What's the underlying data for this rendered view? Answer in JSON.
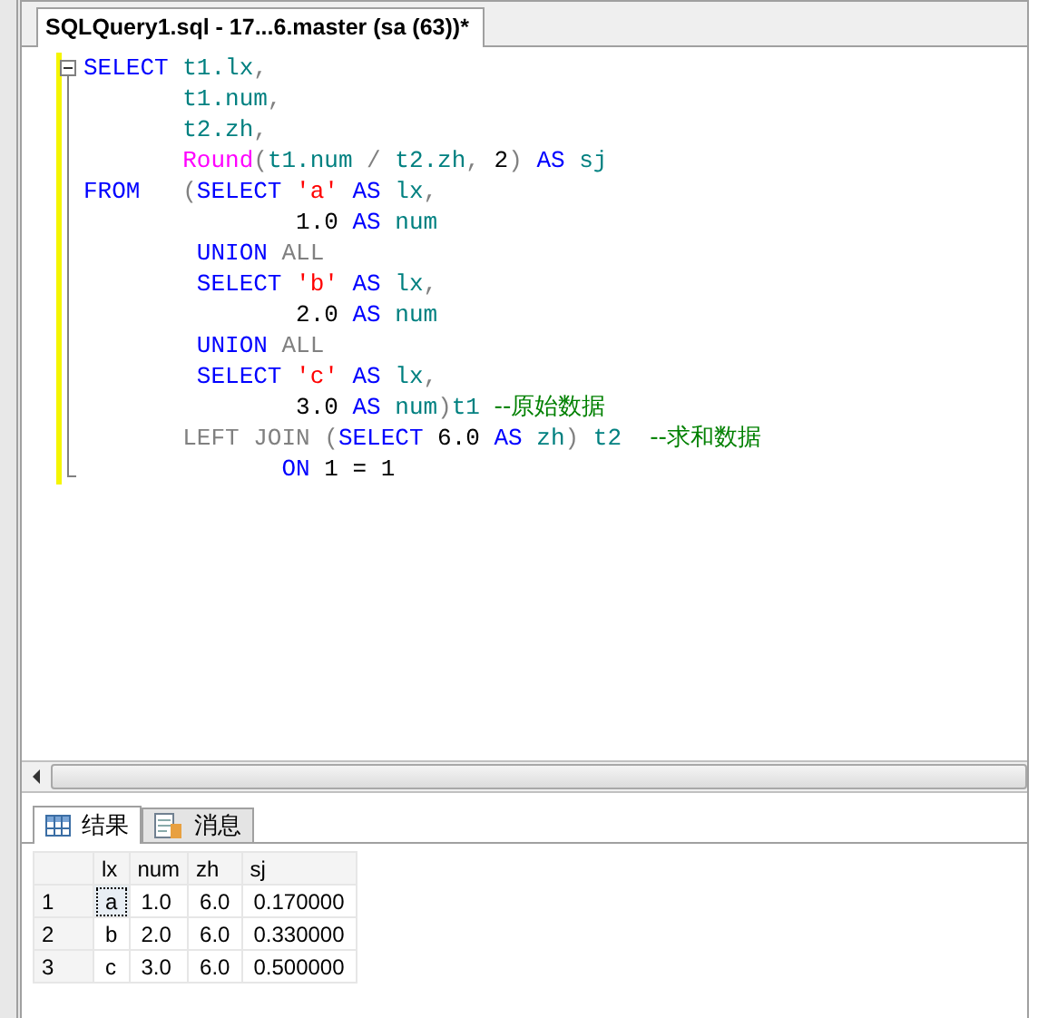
{
  "document_tab": {
    "title": "SQLQuery1.sql - 17...6.master (sa (63))*",
    "selected": true
  },
  "editor": {
    "lines": [
      {
        "changed": true,
        "tokens": [
          {
            "kind": "keyword",
            "text": "SELECT "
          },
          {
            "kind": "identifier",
            "text": "t1.lx"
          },
          {
            "kind": "operator",
            "text": ","
          }
        ]
      },
      {
        "changed": true,
        "tokens": [
          {
            "kind": "identifier",
            "text": "       t1.num"
          },
          {
            "kind": "operator",
            "text": ","
          }
        ]
      },
      {
        "changed": true,
        "tokens": [
          {
            "kind": "identifier",
            "text": "       t2.zh"
          },
          {
            "kind": "operator",
            "text": ","
          }
        ]
      },
      {
        "changed": true,
        "tokens": [
          {
            "kind": "function",
            "text": "       Round"
          },
          {
            "kind": "operator",
            "text": "("
          },
          {
            "kind": "identifier",
            "text": "t1.num"
          },
          {
            "kind": "operator",
            "text": " / "
          },
          {
            "kind": "identifier",
            "text": "t2.zh"
          },
          {
            "kind": "operator",
            "text": ", "
          },
          {
            "kind": "number",
            "text": "2"
          },
          {
            "kind": "operator",
            "text": ")"
          },
          {
            "kind": "keyword",
            "text": " AS "
          },
          {
            "kind": "identifier",
            "text": "sj"
          }
        ]
      },
      {
        "changed": true,
        "tokens": [
          {
            "kind": "keyword",
            "text": "FROM   "
          },
          {
            "kind": "operator",
            "text": "("
          },
          {
            "kind": "keyword",
            "text": "SELECT "
          },
          {
            "kind": "string",
            "text": "'a'"
          },
          {
            "kind": "keyword",
            "text": " AS "
          },
          {
            "kind": "identifier",
            "text": "lx"
          },
          {
            "kind": "operator",
            "text": ","
          }
        ]
      },
      {
        "changed": true,
        "tokens": [
          {
            "kind": "number",
            "text": "               1.0"
          },
          {
            "kind": "keyword",
            "text": " AS "
          },
          {
            "kind": "identifier",
            "text": "num"
          }
        ]
      },
      {
        "changed": true,
        "tokens": [
          {
            "kind": "keyword",
            "text": "        UNION "
          },
          {
            "kind": "operator",
            "text": "ALL"
          }
        ]
      },
      {
        "changed": true,
        "tokens": [
          {
            "kind": "keyword",
            "text": "        SELECT "
          },
          {
            "kind": "string",
            "text": "'b'"
          },
          {
            "kind": "keyword",
            "text": " AS "
          },
          {
            "kind": "identifier",
            "text": "lx"
          },
          {
            "kind": "operator",
            "text": ","
          }
        ]
      },
      {
        "changed": true,
        "tokens": [
          {
            "kind": "number",
            "text": "               2.0"
          },
          {
            "kind": "keyword",
            "text": " AS "
          },
          {
            "kind": "identifier",
            "text": "num"
          }
        ]
      },
      {
        "changed": true,
        "tokens": [
          {
            "kind": "keyword",
            "text": "        UNION "
          },
          {
            "kind": "operator",
            "text": "ALL"
          }
        ]
      },
      {
        "changed": true,
        "tokens": [
          {
            "kind": "keyword",
            "text": "        SELECT "
          },
          {
            "kind": "string",
            "text": "'c'"
          },
          {
            "kind": "keyword",
            "text": " AS "
          },
          {
            "kind": "identifier",
            "text": "lx"
          },
          {
            "kind": "operator",
            "text": ","
          }
        ]
      },
      {
        "changed": true,
        "tokens": [
          {
            "kind": "number",
            "text": "               3.0"
          },
          {
            "kind": "keyword",
            "text": " AS "
          },
          {
            "kind": "identifier",
            "text": "num"
          },
          {
            "kind": "operator",
            "text": ")"
          },
          {
            "kind": "identifier",
            "text": "t1 "
          },
          {
            "kind": "comment",
            "text": "--原始数据"
          }
        ]
      },
      {
        "changed": true,
        "tokens": [
          {
            "kind": "operator",
            "text": "       LEFT JOIN "
          },
          {
            "kind": "operator",
            "text": "("
          },
          {
            "kind": "keyword",
            "text": "SELECT "
          },
          {
            "kind": "number",
            "text": "6.0"
          },
          {
            "kind": "keyword",
            "text": " AS "
          },
          {
            "kind": "identifier",
            "text": "zh"
          },
          {
            "kind": "operator",
            "text": ") "
          },
          {
            "kind": "identifier",
            "text": "t2  "
          },
          {
            "kind": "comment",
            "text": "--求和数据"
          }
        ]
      },
      {
        "changed": true,
        "tokens": [
          {
            "kind": "keyword",
            "text": "              ON "
          },
          {
            "kind": "number",
            "text": "1 = 1"
          }
        ]
      }
    ]
  },
  "result_tabs": [
    {
      "label": "结果",
      "kind": "grid",
      "selected": true
    },
    {
      "label": "消息",
      "kind": "messages",
      "selected": false
    }
  ],
  "grid": {
    "columns": [
      "lx",
      "num",
      "zh",
      "sj"
    ],
    "rows": [
      {
        "number": "1",
        "cells": [
          {
            "text": "a",
            "focused": true
          },
          {
            "text": "1.0",
            "focused": false
          },
          {
            "text": "6.0",
            "focused": false
          },
          {
            "text": "0.170000",
            "focused": false
          }
        ]
      },
      {
        "number": "2",
        "cells": [
          {
            "text": "b",
            "focused": false
          },
          {
            "text": "2.0",
            "focused": false
          },
          {
            "text": "6.0",
            "focused": false
          },
          {
            "text": "0.330000",
            "focused": false
          }
        ]
      },
      {
        "number": "3",
        "cells": [
          {
            "text": "c",
            "focused": false
          },
          {
            "text": "3.0",
            "focused": false
          },
          {
            "text": "6.0",
            "focused": false
          },
          {
            "text": "0.500000",
            "focused": false
          }
        ]
      }
    ]
  }
}
